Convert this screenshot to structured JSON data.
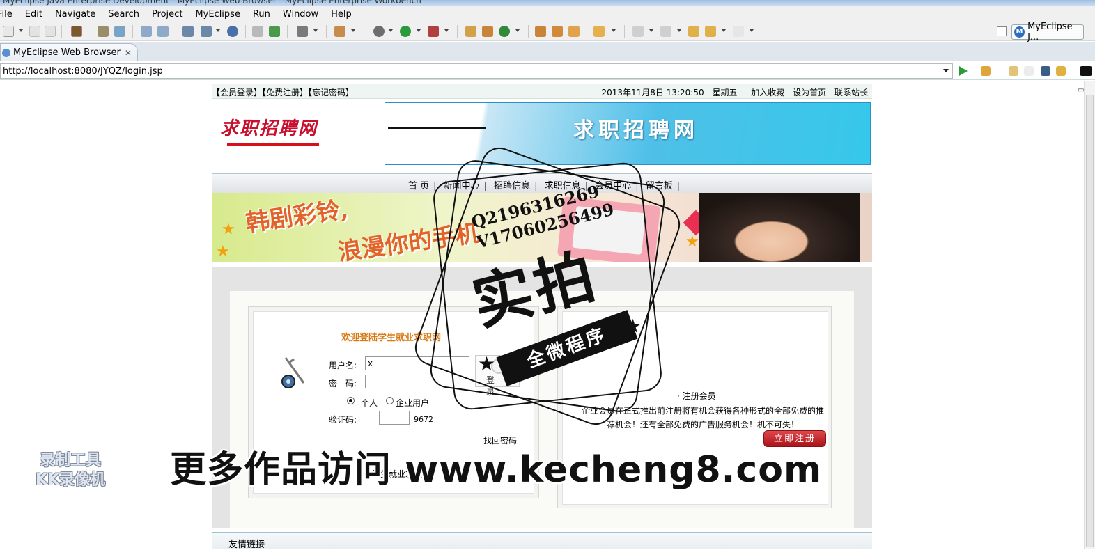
{
  "window": {
    "title": "MyEclipse Java Enterprise Development - MyEclipse Web Browser - MyEclipse Enterprise Workbench"
  },
  "menu": [
    "File",
    "Edit",
    "Navigate",
    "Search",
    "Project",
    "MyEclipse",
    "Run",
    "Window",
    "Help"
  ],
  "perspective": {
    "label": "MyEclipse J..."
  },
  "editor_tab": {
    "label": "MyEclipse Web Browser",
    "close": "✕"
  },
  "address": {
    "url": "http://localhost:8080/JYQZ/login.jsp"
  },
  "page": {
    "top_left": "【会员登录】【免费注册】【忘记密码】",
    "date": "2013年11月8日 13:20:50",
    "weekday": "星期五",
    "top_links": [
      "加入收藏",
      "设为首页",
      "联系站长"
    ],
    "logo": "求职招聘网",
    "banner_text": "求职招聘网",
    "nav": [
      "首 页",
      "新闻中心",
      "招聘信息",
      "求职信息",
      "会员中心",
      "留言板"
    ],
    "ad_slogan_1": "韩剧彩铃,",
    "ad_slogan_2": "浪漫你的手机",
    "login": {
      "welcome": "欢迎登陆学生就业求职网",
      "username_label": "用户名:",
      "username_value": "x",
      "password_label": "密　码:",
      "password_value": "",
      "login_button": "登录",
      "user_type_options": [
        "个人",
        "企业用户"
      ],
      "user_type_selected": "个人",
      "captcha_label": "验证码:",
      "captcha_value": "",
      "captcha_code": "9672",
      "forgot_link": "找回密码",
      "footer_text": "学生就业求职网"
    },
    "register": {
      "title": "· 注册会员",
      "description": "企业会员在正式推出前注册将有机会获得各种形式的全部免费的推荐机会！还有全部免费的广告服务机会！机不可失！",
      "button": "立即注册"
    },
    "friend_links": "友情链接"
  },
  "watermarks": {
    "stamp_line1": "Q2196316269",
    "stamp_line2": "V17060256499",
    "stamp_big": "实拍",
    "stamp_ribbon": "全微程序",
    "site": "更多作品访问 www.kecheng8.com",
    "recorder_line1": "录制工具",
    "recorder_line2": "KK录像机"
  }
}
